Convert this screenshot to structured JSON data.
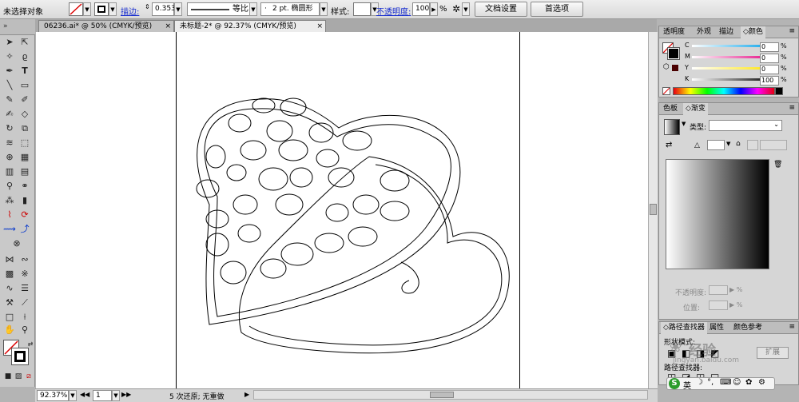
{
  "control_bar": {
    "selection_label": "未选择对象",
    "stroke_label": "描边:",
    "stroke_width": "0.353",
    "profile_label": "等比",
    "brush_label": "2 pt. 椭圆形",
    "style_label": "样式:",
    "opacity_label": "不透明度:",
    "opacity_value": "100",
    "percent": "%",
    "doc_setup_button": "文档设置",
    "prefs_button": "首选项"
  },
  "doc_tabs": [
    {
      "label": "06236.ai* @ 50% (CMYK/预览)"
    },
    {
      "label": "未标题-2* @ 92.37% (CMYK/预览)"
    }
  ],
  "status": {
    "zoom": "92.37%",
    "page": "1",
    "message": "5 次还原; 无重做"
  },
  "color_panel": {
    "tabs": [
      "透明度",
      "外观",
      "描边",
      "颜色"
    ],
    "channels": [
      {
        "name": "C",
        "value": "0"
      },
      {
        "name": "M",
        "value": "0"
      },
      {
        "name": "Y",
        "value": "0"
      },
      {
        "name": "K",
        "value": "100"
      }
    ],
    "colors": {
      "cyan": "#00a0e9",
      "magenta": "#e4007f",
      "yellow": "#ffe400",
      "black": "#000000"
    }
  },
  "gradient_panel": {
    "tabs": [
      "色板",
      "渐变"
    ],
    "type_label": "类型:",
    "opacity_label": "不透明度:",
    "position_label": "位置:"
  },
  "bottom_panel": {
    "tabs": [
      "路径查找器",
      "属性",
      "颜色参考"
    ],
    "shape_mode_label": "形状模式:",
    "expand_button": "扩展",
    "pathfinder_label": "路径查找器:"
  },
  "taskbar": {
    "ime_label": "英"
  },
  "watermark": {
    "text": "经验",
    "url": "jingyan.baidu.com"
  }
}
